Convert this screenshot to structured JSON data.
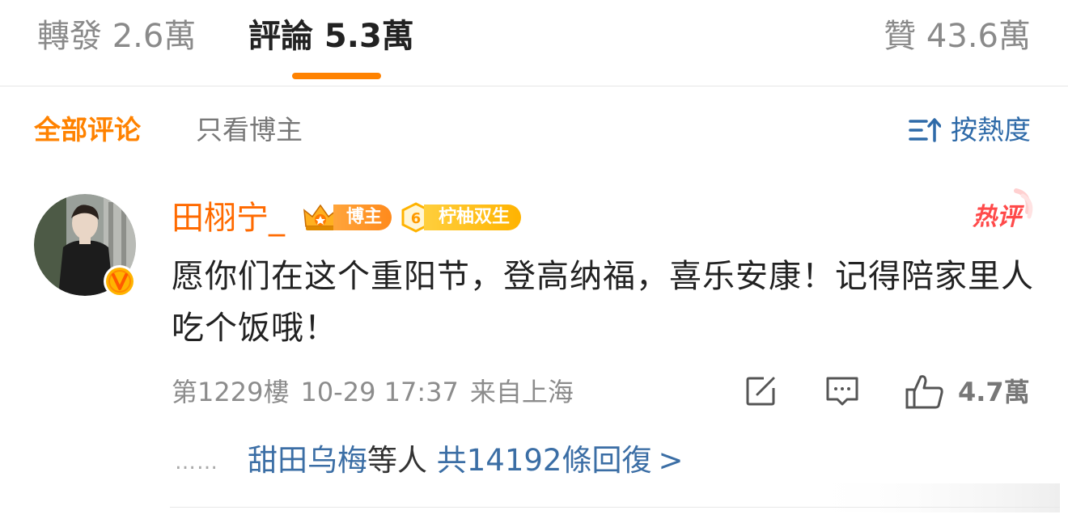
{
  "tabs": [
    {
      "label": "轉發 2.6萬"
    },
    {
      "label": "評論 5.3萬"
    },
    {
      "label": "贊 43.6萬"
    }
  ],
  "filters": {
    "all_comments": "全部评论",
    "only_blogger": "只看博主",
    "sort_label": "按熱度"
  },
  "comment": {
    "username": "田栩宁_",
    "owner_badge": "博主",
    "fan_badge_level": "6",
    "fan_badge": "柠柚双生",
    "hot_label": "热评",
    "text": "愿你们在这个重阳节，登高纳福，喜乐安康！记得陪家里人吃个饭哦！",
    "floor": "第1229樓",
    "datetime": "10-29 17:37",
    "location": "来自上海",
    "like_count": "4.7萬",
    "avatar_badge": "V"
  },
  "replies": {
    "dots": "……",
    "names": "甜田乌梅",
    "middle": "等人",
    "count_text": "共14192條回復",
    "chevron": ">"
  },
  "colors": {
    "accent_orange": "#ff8200",
    "username_orange": "#ff6a00",
    "link_blue": "#3b6ea5",
    "hot_red": "#ff4a4a"
  },
  "icons": [
    "sort-icon",
    "share-icon",
    "comment-icon",
    "like-icon",
    "owner-crown-icon",
    "fan-level-icon",
    "hot-comment-icon",
    "verified-v-icon"
  ]
}
